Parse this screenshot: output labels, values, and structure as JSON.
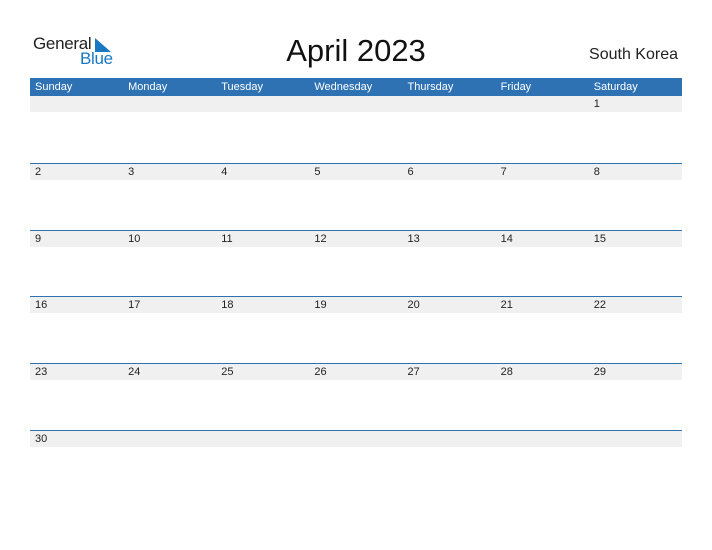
{
  "logo": {
    "word1": "General",
    "word2": "Blue"
  },
  "title": "April 2023",
  "country": "South Korea",
  "colors": {
    "header_bg": "#2e72b4",
    "row_band": "#f0f0f0",
    "brand_blue": "#1a78c2"
  },
  "weekdays": [
    "Sunday",
    "Monday",
    "Tuesday",
    "Wednesday",
    "Thursday",
    "Friday",
    "Saturday"
  ],
  "weeks": [
    [
      "",
      "",
      "",
      "",
      "",
      "",
      "1"
    ],
    [
      "2",
      "3",
      "4",
      "5",
      "6",
      "7",
      "8"
    ],
    [
      "9",
      "10",
      "11",
      "12",
      "13",
      "14",
      "15"
    ],
    [
      "16",
      "17",
      "18",
      "19",
      "20",
      "21",
      "22"
    ],
    [
      "23",
      "24",
      "25",
      "26",
      "27",
      "28",
      "29"
    ],
    [
      "30",
      "",
      "",
      "",
      "",
      "",
      ""
    ]
  ]
}
